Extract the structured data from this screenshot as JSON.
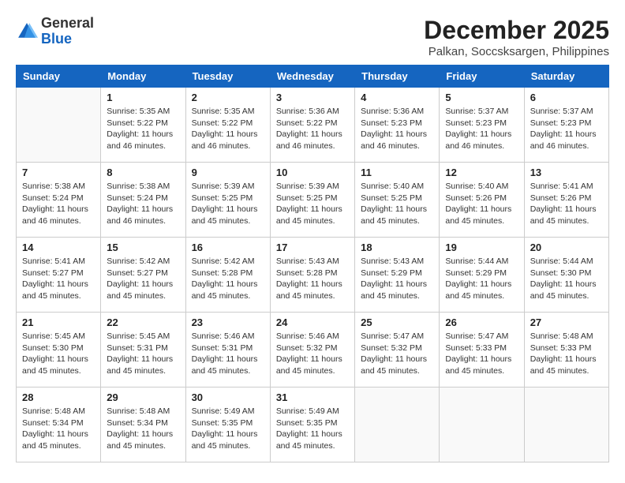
{
  "header": {
    "logo_general": "General",
    "logo_blue": "Blue",
    "month_title": "December 2025",
    "location": "Palkan, Soccsksargen, Philippines"
  },
  "weekdays": [
    "Sunday",
    "Monday",
    "Tuesday",
    "Wednesday",
    "Thursday",
    "Friday",
    "Saturday"
  ],
  "weeks": [
    [
      {
        "day": "",
        "info": ""
      },
      {
        "day": "1",
        "info": "Sunrise: 5:35 AM\nSunset: 5:22 PM\nDaylight: 11 hours and 46 minutes."
      },
      {
        "day": "2",
        "info": "Sunrise: 5:35 AM\nSunset: 5:22 PM\nDaylight: 11 hours and 46 minutes."
      },
      {
        "day": "3",
        "info": "Sunrise: 5:36 AM\nSunset: 5:22 PM\nDaylight: 11 hours and 46 minutes."
      },
      {
        "day": "4",
        "info": "Sunrise: 5:36 AM\nSunset: 5:23 PM\nDaylight: 11 hours and 46 minutes."
      },
      {
        "day": "5",
        "info": "Sunrise: 5:37 AM\nSunset: 5:23 PM\nDaylight: 11 hours and 46 minutes."
      },
      {
        "day": "6",
        "info": "Sunrise: 5:37 AM\nSunset: 5:23 PM\nDaylight: 11 hours and 46 minutes."
      }
    ],
    [
      {
        "day": "7",
        "info": "Sunrise: 5:38 AM\nSunset: 5:24 PM\nDaylight: 11 hours and 46 minutes."
      },
      {
        "day": "8",
        "info": "Sunrise: 5:38 AM\nSunset: 5:24 PM\nDaylight: 11 hours and 46 minutes."
      },
      {
        "day": "9",
        "info": "Sunrise: 5:39 AM\nSunset: 5:25 PM\nDaylight: 11 hours and 45 minutes."
      },
      {
        "day": "10",
        "info": "Sunrise: 5:39 AM\nSunset: 5:25 PM\nDaylight: 11 hours and 45 minutes."
      },
      {
        "day": "11",
        "info": "Sunrise: 5:40 AM\nSunset: 5:25 PM\nDaylight: 11 hours and 45 minutes."
      },
      {
        "day": "12",
        "info": "Sunrise: 5:40 AM\nSunset: 5:26 PM\nDaylight: 11 hours and 45 minutes."
      },
      {
        "day": "13",
        "info": "Sunrise: 5:41 AM\nSunset: 5:26 PM\nDaylight: 11 hours and 45 minutes."
      }
    ],
    [
      {
        "day": "14",
        "info": "Sunrise: 5:41 AM\nSunset: 5:27 PM\nDaylight: 11 hours and 45 minutes."
      },
      {
        "day": "15",
        "info": "Sunrise: 5:42 AM\nSunset: 5:27 PM\nDaylight: 11 hours and 45 minutes."
      },
      {
        "day": "16",
        "info": "Sunrise: 5:42 AM\nSunset: 5:28 PM\nDaylight: 11 hours and 45 minutes."
      },
      {
        "day": "17",
        "info": "Sunrise: 5:43 AM\nSunset: 5:28 PM\nDaylight: 11 hours and 45 minutes."
      },
      {
        "day": "18",
        "info": "Sunrise: 5:43 AM\nSunset: 5:29 PM\nDaylight: 11 hours and 45 minutes."
      },
      {
        "day": "19",
        "info": "Sunrise: 5:44 AM\nSunset: 5:29 PM\nDaylight: 11 hours and 45 minutes."
      },
      {
        "day": "20",
        "info": "Sunrise: 5:44 AM\nSunset: 5:30 PM\nDaylight: 11 hours and 45 minutes."
      }
    ],
    [
      {
        "day": "21",
        "info": "Sunrise: 5:45 AM\nSunset: 5:30 PM\nDaylight: 11 hours and 45 minutes."
      },
      {
        "day": "22",
        "info": "Sunrise: 5:45 AM\nSunset: 5:31 PM\nDaylight: 11 hours and 45 minutes."
      },
      {
        "day": "23",
        "info": "Sunrise: 5:46 AM\nSunset: 5:31 PM\nDaylight: 11 hours and 45 minutes."
      },
      {
        "day": "24",
        "info": "Sunrise: 5:46 AM\nSunset: 5:32 PM\nDaylight: 11 hours and 45 minutes."
      },
      {
        "day": "25",
        "info": "Sunrise: 5:47 AM\nSunset: 5:32 PM\nDaylight: 11 hours and 45 minutes."
      },
      {
        "day": "26",
        "info": "Sunrise: 5:47 AM\nSunset: 5:33 PM\nDaylight: 11 hours and 45 minutes."
      },
      {
        "day": "27",
        "info": "Sunrise: 5:48 AM\nSunset: 5:33 PM\nDaylight: 11 hours and 45 minutes."
      }
    ],
    [
      {
        "day": "28",
        "info": "Sunrise: 5:48 AM\nSunset: 5:34 PM\nDaylight: 11 hours and 45 minutes."
      },
      {
        "day": "29",
        "info": "Sunrise: 5:48 AM\nSunset: 5:34 PM\nDaylight: 11 hours and 45 minutes."
      },
      {
        "day": "30",
        "info": "Sunrise: 5:49 AM\nSunset: 5:35 PM\nDaylight: 11 hours and 45 minutes."
      },
      {
        "day": "31",
        "info": "Sunrise: 5:49 AM\nSunset: 5:35 PM\nDaylight: 11 hours and 45 minutes."
      },
      {
        "day": "",
        "info": ""
      },
      {
        "day": "",
        "info": ""
      },
      {
        "day": "",
        "info": ""
      }
    ]
  ]
}
